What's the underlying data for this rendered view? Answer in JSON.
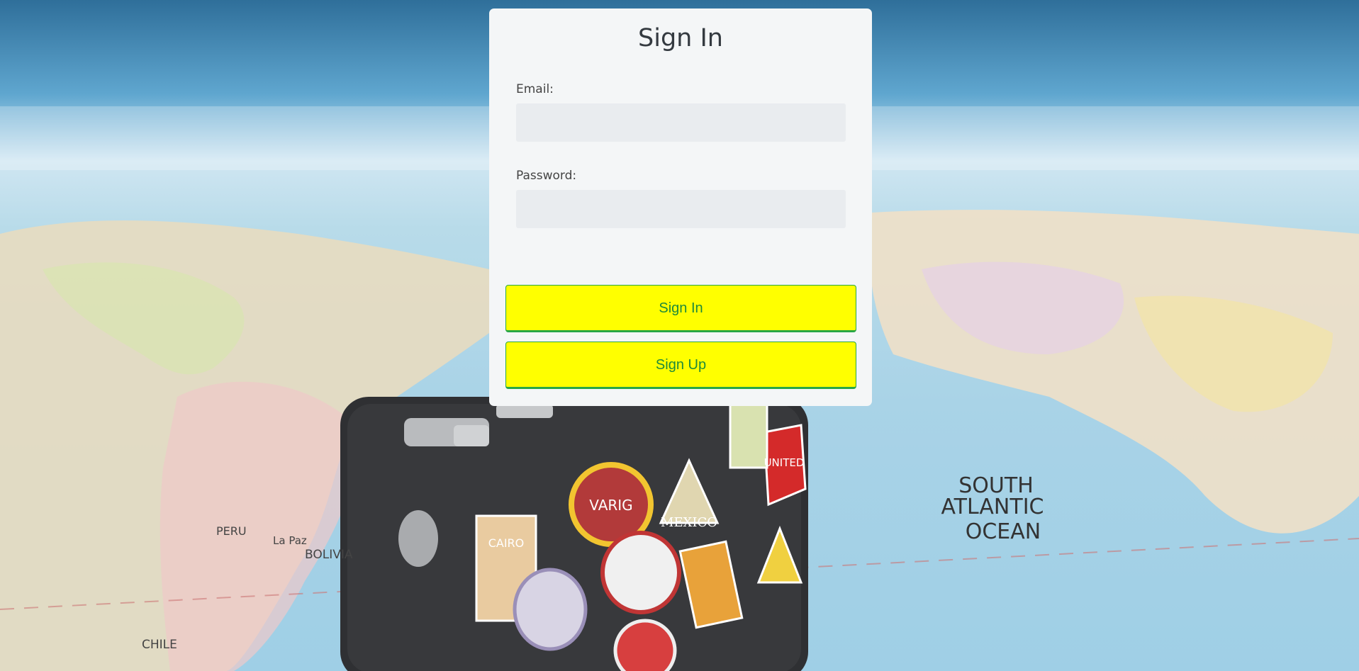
{
  "background": {
    "map_labels": [
      "SOUTH",
      "ATLANTIC",
      "OCEAN"
    ],
    "decor_labels": [
      "PERU",
      "BOLIVIA",
      "La Paz",
      "CHILE",
      "CAIRO",
      "MEXICO",
      "VARIG",
      "UNITED"
    ]
  },
  "form": {
    "title": "Sign In",
    "email_label": "Email:",
    "email_value": "",
    "password_label": "Password:",
    "password_value": "",
    "signin_button": "Sign In",
    "signup_button": "Sign Up"
  },
  "colors": {
    "button_bg": "#ffff00",
    "button_border": "#28a745",
    "button_text": "#1f8a3a",
    "card_bg": "#f4f6f7",
    "input_bg": "#e9ecef"
  }
}
